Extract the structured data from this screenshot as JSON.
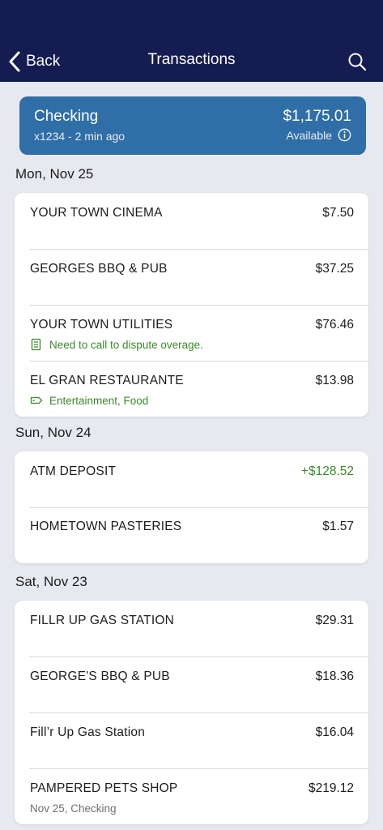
{
  "header": {
    "back_label": "Back",
    "title": "Transactions"
  },
  "account": {
    "name": "Checking",
    "subtitle": "x1234 - 2 min ago",
    "balance": "$1,175.01",
    "available_label": "Available"
  },
  "groups": [
    {
      "date": "Mon, Nov 25",
      "transactions": [
        {
          "merchant": "YOUR TOWN CINEMA",
          "amount": "$7.50"
        },
        {
          "merchant": "GEORGES BBQ & PUB",
          "amount": "$37.25"
        },
        {
          "merchant": "YOUR TOWN UTILITIES",
          "amount": "$76.46",
          "note": "Need to call to dispute overage."
        },
        {
          "merchant": "EL GRAN RESTAURANTE",
          "amount": "$13.98",
          "tags": "Entertainment, Food"
        }
      ]
    },
    {
      "date": "Sun, Nov 24",
      "transactions": [
        {
          "merchant": "ATM DEPOSIT",
          "amount": "+$128.52"
        },
        {
          "merchant": "HOMETOWN PASTERIES",
          "amount": "$1.57"
        }
      ]
    },
    {
      "date": "Sat, Nov 23",
      "transactions": [
        {
          "merchant": "FILLR UP GAS STATION",
          "amount": "$29.31"
        },
        {
          "merchant": "GEORGE'S BBQ & PUB",
          "amount": "$18.36"
        },
        {
          "merchant": "Fill’r Up Gas Station",
          "amount": "$16.04"
        },
        {
          "merchant": "PAMPERED PETS SHOP",
          "amount": "$219.12",
          "detail": "Nov 25, Checking"
        }
      ]
    }
  ],
  "colors": {
    "header_bg": "#141c52",
    "account_card": "#2f6ea7",
    "credit_amount": "#3b8a2a",
    "note_text": "#3b8a2a"
  },
  "icons": {
    "back": "chevron-left-icon",
    "search": "search-icon",
    "info": "info-icon",
    "note": "note-icon",
    "tag": "tag-icon"
  }
}
